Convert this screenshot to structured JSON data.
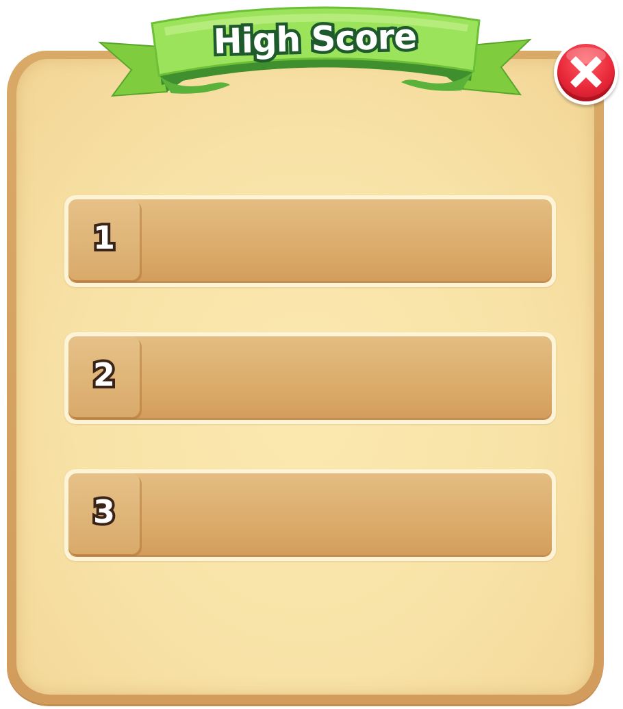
{
  "dialog": {
    "title": "High Score",
    "close_icon": "close-x-icon"
  },
  "colors": {
    "ribbon_green": "#8fd84b",
    "ribbon_dark": "#1f5a2c",
    "parchment": "#f8e2a6",
    "panel_border": "#d9a967",
    "close_red": "#e8283a",
    "row_bar": "#dcad6c"
  },
  "scores": [
    {
      "rank": "1",
      "value": ""
    },
    {
      "rank": "2",
      "value": ""
    },
    {
      "rank": "3",
      "value": ""
    }
  ]
}
